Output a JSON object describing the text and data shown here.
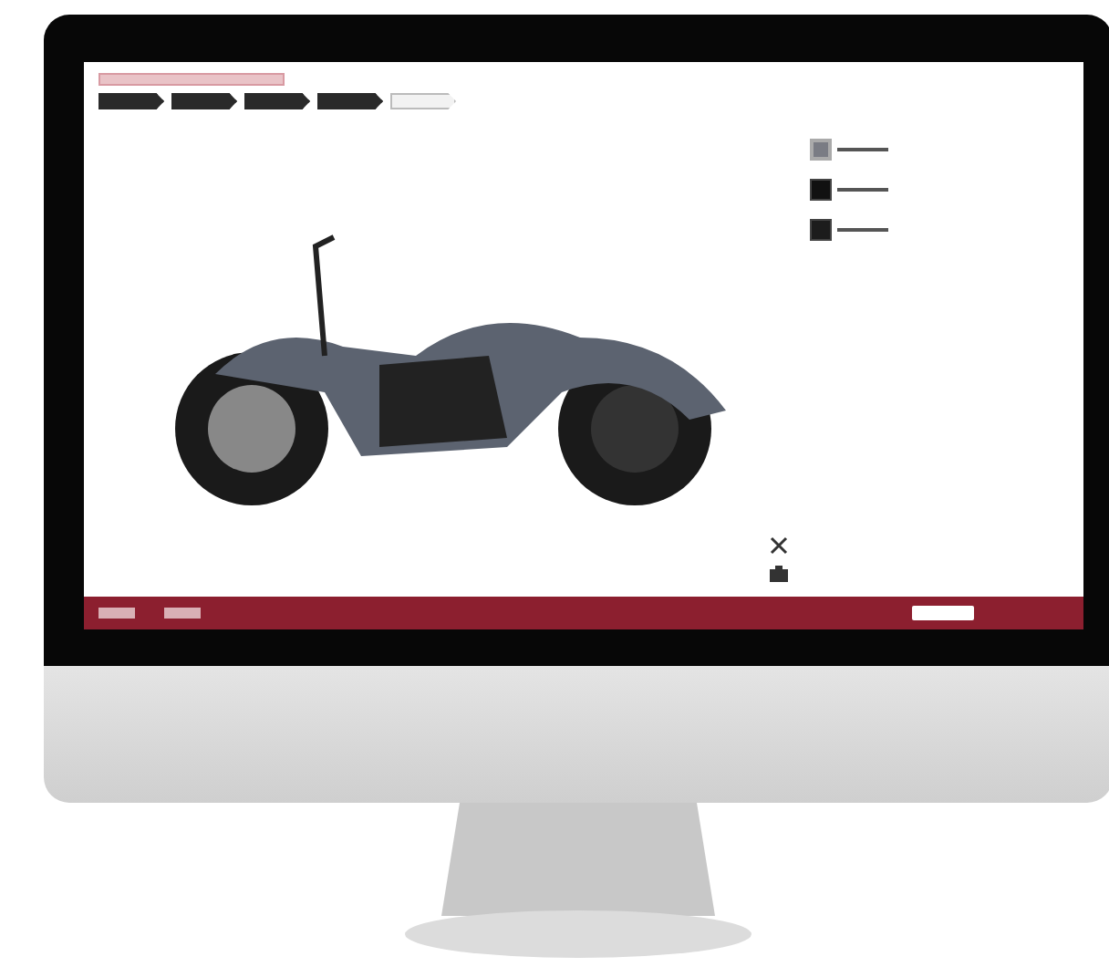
{
  "steps": [
    {
      "selected": false
    },
    {
      "selected": false
    },
    {
      "selected": false
    },
    {
      "selected": false
    },
    {
      "selected": true
    }
  ],
  "swatches": [
    {
      "color": "#7a7c84",
      "selected": true
    },
    {
      "color": "#111111",
      "selected": false
    },
    {
      "color": "#1c1c1c",
      "selected": false
    }
  ]
}
